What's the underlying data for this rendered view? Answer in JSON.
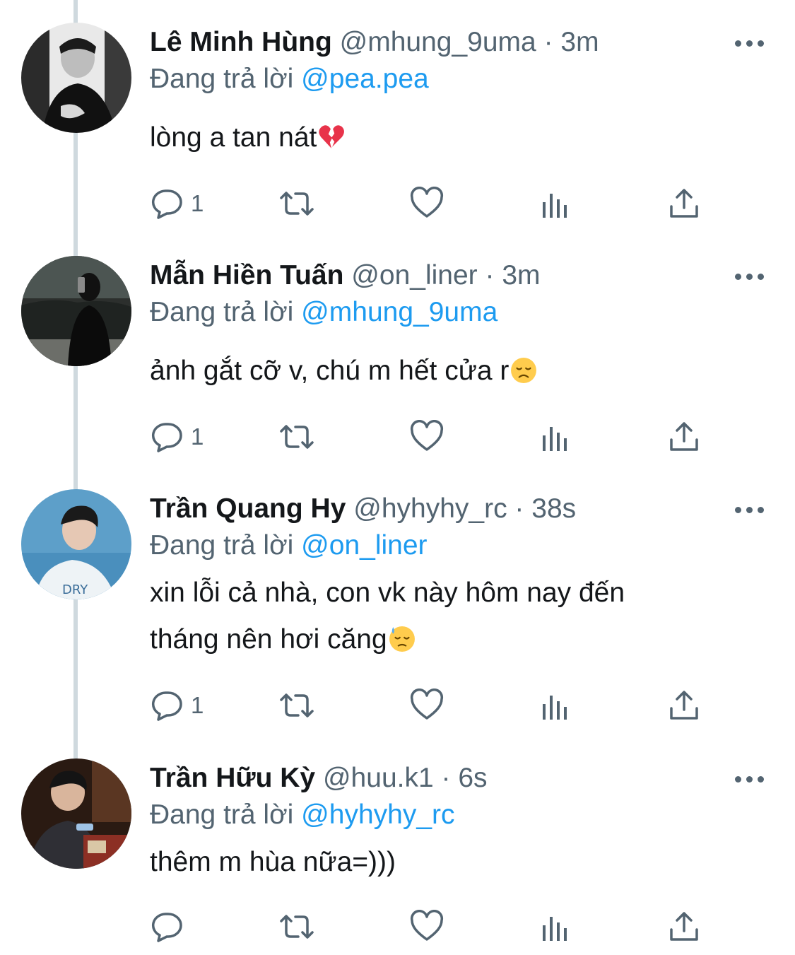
{
  "colors": {
    "accent": "#1d9bf0",
    "muted": "#536471",
    "text": "#14171a",
    "thread_line": "#cfd9de"
  },
  "tweets": [
    {
      "name": "Lê Minh Hùng",
      "handle": "@mhung_9uma",
      "separator": "·",
      "time": "3m",
      "replying_label": "Đang trả lời",
      "replying_to": "@pea.pea",
      "text_lines": [
        "lòng a tan nát"
      ],
      "emoji": "broken-heart",
      "reply_count": "1"
    },
    {
      "name": "Mẫn Hiền Tuấn",
      "handle": "@on_liner",
      "separator": "·",
      "time": "3m",
      "replying_label": "Đang trả lời",
      "replying_to": "@mhung_9uma",
      "text_lines": [
        "ảnh gắt cỡ v, chú m hết cửa r"
      ],
      "emoji": "disappointed-face",
      "reply_count": "1"
    },
    {
      "name": "Trần Quang Hy",
      "handle": "@hyhyhy_rc",
      "separator": "·",
      "time": "38s",
      "replying_label": "Đang trả lời",
      "replying_to": "@on_liner",
      "text_lines": [
        "xin lỗi cả nhà, con vk này hôm nay đến",
        "tháng nên hơi căng"
      ],
      "emoji": "downcast-sweat-face",
      "reply_count": "1"
    },
    {
      "name": "Trần Hữu Kỳ",
      "handle": "@huu.k1",
      "separator": "·",
      "time": "6s",
      "replying_label": "Đang trả lời",
      "replying_to": "@hyhyhy_rc",
      "text_lines": [
        "thêm m hùa nữa=)))"
      ],
      "emoji": "",
      "reply_count": ""
    }
  ],
  "icons": {
    "reply": "reply-bubble-icon",
    "retweet": "retweet-icon",
    "like": "heart-icon",
    "views": "analytics-bars-icon",
    "share": "share-upload-icon",
    "more": "more-dots-icon"
  }
}
